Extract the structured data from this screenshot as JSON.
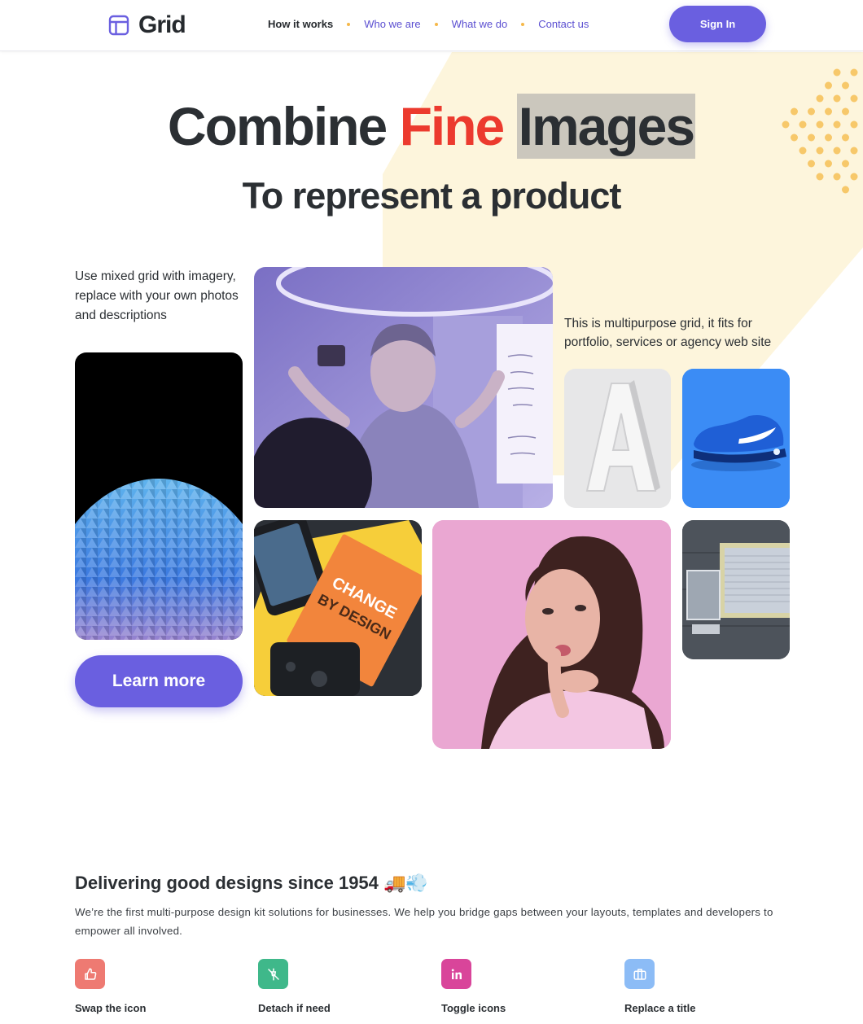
{
  "header": {
    "logo_text": "Grid",
    "nav": [
      {
        "label": "How it works"
      },
      {
        "label": "Who we are"
      },
      {
        "label": "What we do"
      },
      {
        "label": "Contact us"
      }
    ],
    "sign_in": "Sign In"
  },
  "hero": {
    "title_word1": "Combine",
    "title_word2": "Fine",
    "title_word3": "Images",
    "subtitle": "To represent a product"
  },
  "grid": {
    "desc_left": "Use mixed grid with imagery, replace with your own photos and descriptions",
    "desc_right": "This is multipurpose grid, it fits for portfolio, services or agency web site",
    "book_line1": "CHANGE",
    "book_line2": "BY DESIGN",
    "learn_more": "Learn more"
  },
  "section": {
    "title": "Delivering good designs since 1954 🚚💨",
    "text": "We’re the first multi-purpose design kit solutions for businesses. We help you bridge gaps between your layouts, templates and developers to empower all involved.",
    "features": [
      {
        "label": "Swap the icon",
        "icon": "thumbs-up-icon"
      },
      {
        "label": "Detach if need",
        "icon": "detach-icon"
      },
      {
        "label": "Toggle icons",
        "icon": "linkedin-icon"
      },
      {
        "label": "Replace a title",
        "icon": "briefcase-icon"
      }
    ]
  },
  "colors": {
    "accent": "#6a5fe0",
    "highlight_red": "#ec3a2e",
    "highlight_mint": "#82e8c3",
    "highlight_gray": "#cbc7bd",
    "deco_yellow": "#fdf5dc",
    "deco_dots": "#f7c86a"
  }
}
